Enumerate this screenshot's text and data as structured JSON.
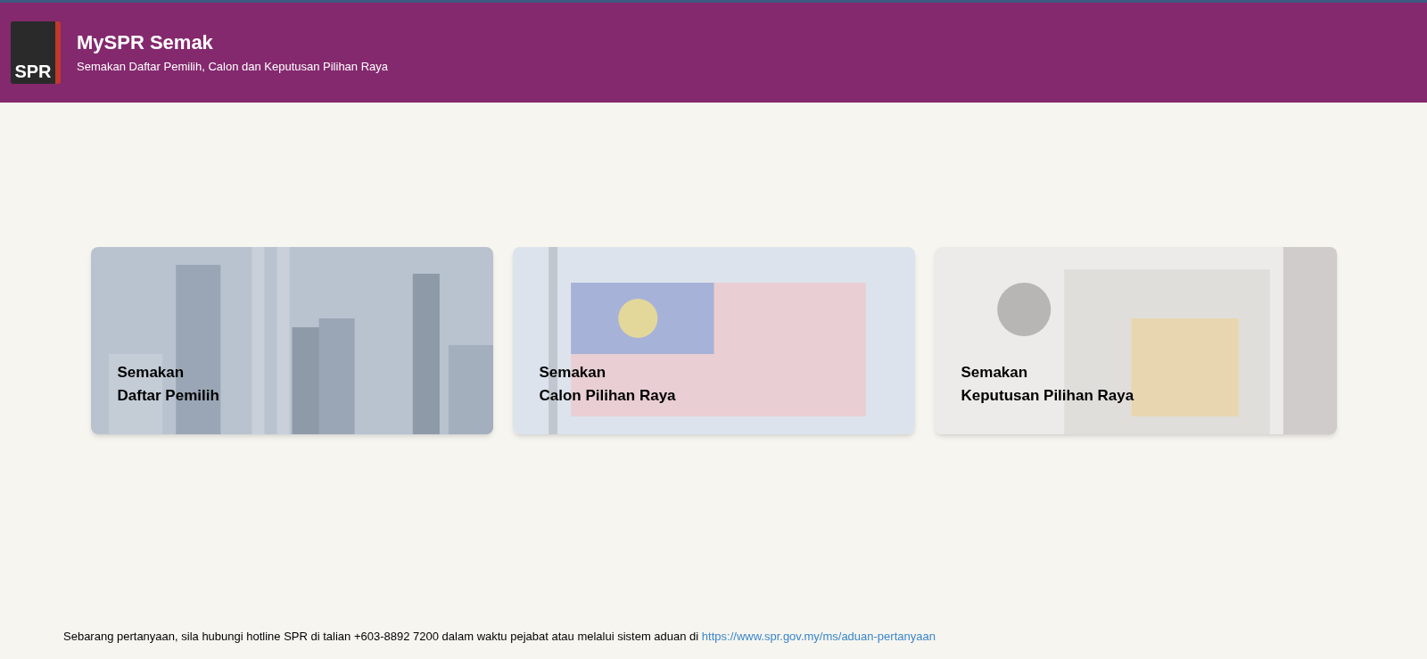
{
  "header": {
    "logo_text": "SPR",
    "title": "MySPR Semak",
    "subtitle": "Semakan Daftar Pemilih, Calon dan Keputusan Pilihan Raya"
  },
  "cards": [
    {
      "kind": "city",
      "lines": [
        "Semakan",
        "Daftar Pemilih"
      ]
    },
    {
      "kind": "flag",
      "lines": [
        "Semakan",
        "Calon Pilihan Raya"
      ]
    },
    {
      "kind": "ballot",
      "lines": [
        "Semakan",
        "Keputusan Pilihan Raya"
      ]
    }
  ],
  "footer": {
    "text": "Sebarang pertanyaan, sila hubungi hotline SPR di talian +603-8892 7200 dalam waktu pejabat atau melalui sistem aduan di",
    "link": "https://www.spr.gov.my/ms/aduan-pertanyaan"
  }
}
